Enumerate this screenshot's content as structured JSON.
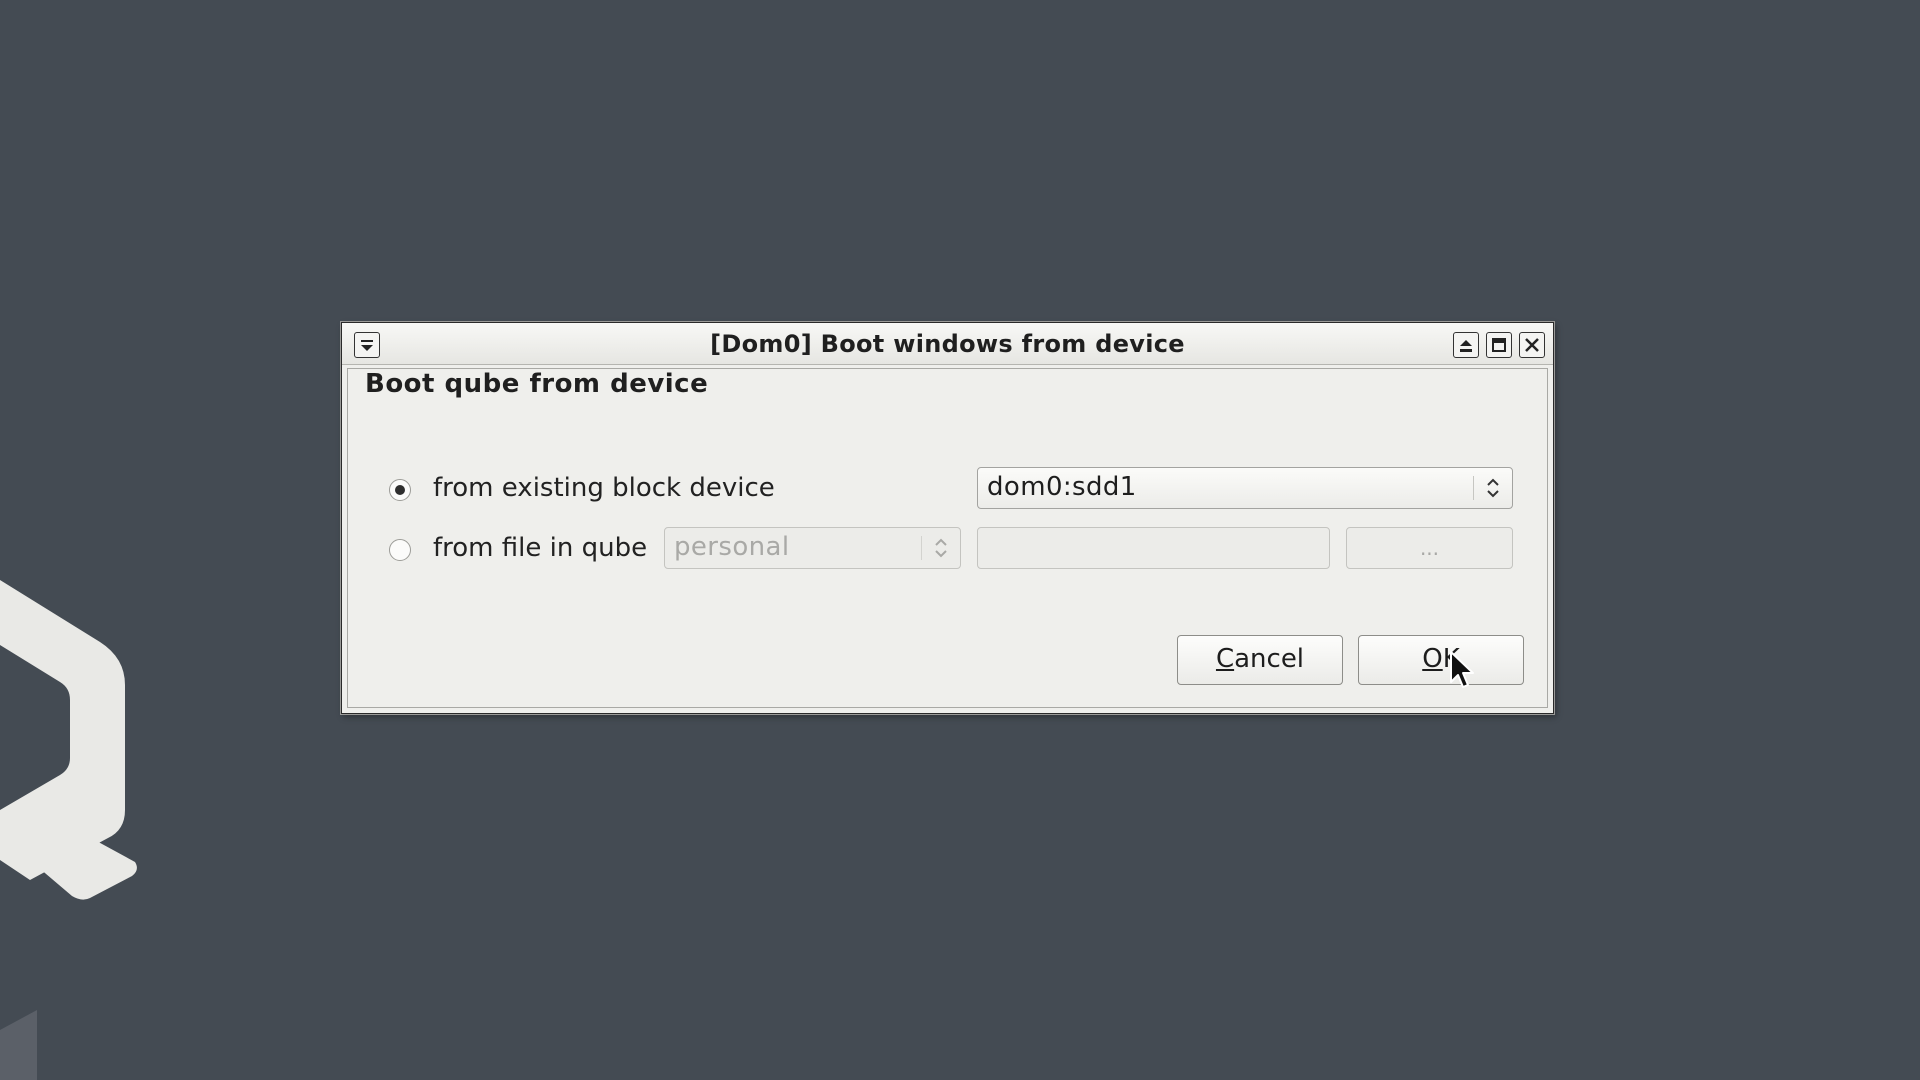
{
  "window": {
    "title": "[Dom0] Boot windows from device"
  },
  "dialog": {
    "heading": "Boot qube from device",
    "option_existing_label": "from existing block device",
    "option_existing_checked": true,
    "option_file_label": "from file in qube",
    "option_file_checked": false,
    "device_select_value": "dom0:sdd1",
    "qube_select_value": "personal",
    "file_path_value": "",
    "browse_label": "...",
    "cancel_mnemonic": "C",
    "cancel_rest": "ancel",
    "ok_mnemonic": "O",
    "ok_rest": "K"
  },
  "icons": {
    "window_menu": "window-menu-icon",
    "shade": "shade-icon",
    "maximize": "maximize-icon",
    "close": "close-icon",
    "select_arrows": "updown-arrows-icon",
    "cursor": "mouse-cursor-icon",
    "logo": "qubes-logo"
  },
  "colors": {
    "desktop": "#444b53",
    "dialog": "#efefec",
    "logo": "#e9e9e6"
  }
}
